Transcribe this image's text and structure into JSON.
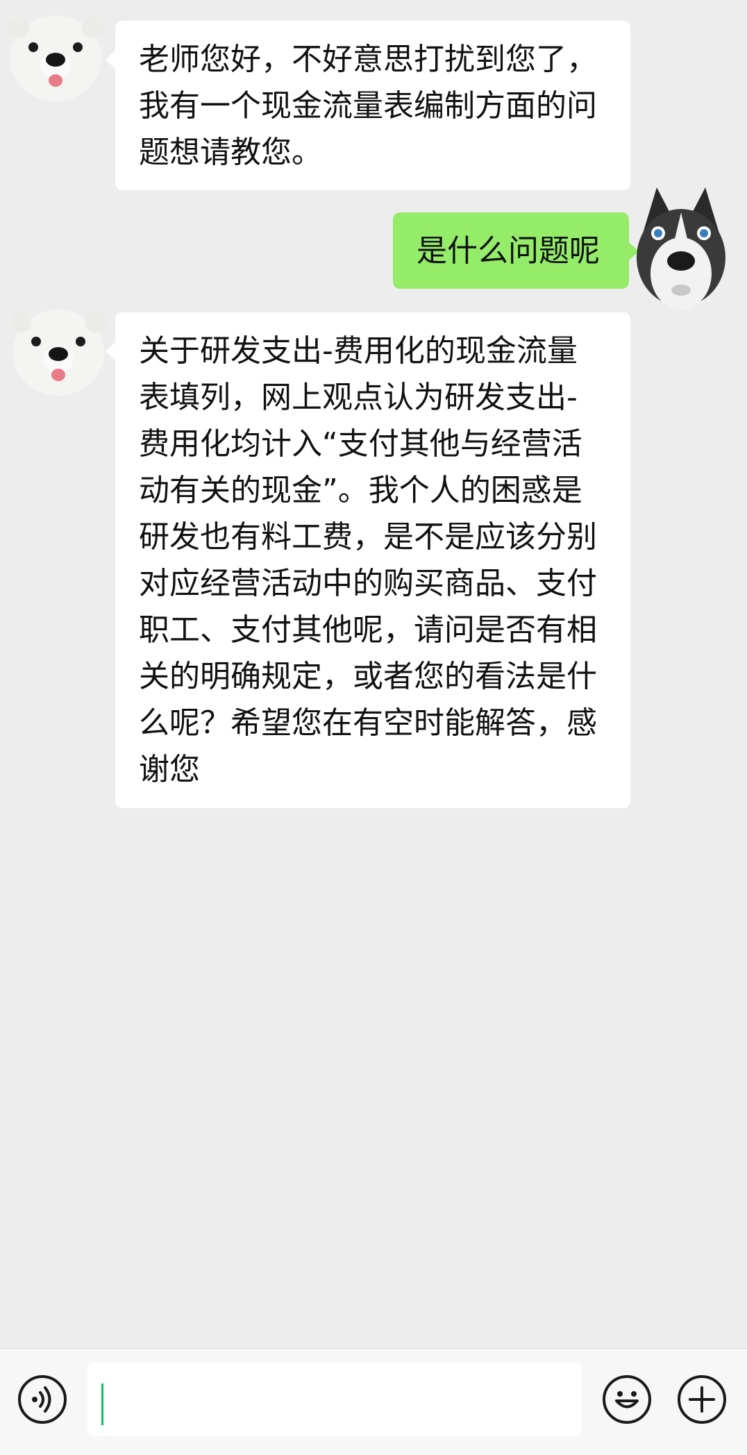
{
  "colors": {
    "background": "#ededed",
    "incoming_bubble": "#ffffff",
    "outgoing_bubble": "#95ec69",
    "caret": "#07c160"
  },
  "messages": [
    {
      "sender": "other",
      "avatar_icon": "polar-bear-avatar-icon",
      "lines": [
        "老师您好，不好意思打扰到您了，",
        "我有一个现金流量表编制方面的问",
        "题想请教您。"
      ]
    },
    {
      "sender": "self",
      "avatar_icon": "husky-avatar-icon",
      "lines": [
        "是什么问题呢"
      ]
    },
    {
      "sender": "other",
      "avatar_icon": "polar-bear-avatar-icon",
      "lines": [
        "关于研发支出-费用化的现金流量",
        "表填列，网上观点认为研发支出-",
        "费用化均计入“支付其他与经营活",
        "动有关的现金”。我个人的困惑是",
        "研发也有料工费，是不是应该分别",
        "对应经营活动中的购买商品、支付",
        "职工、支付其他呢，请问是否有相",
        "关的明确规定，或者您的看法是什",
        "么呢？希望您在有空时能解答，感",
        "谢您"
      ]
    }
  ],
  "input_bar": {
    "voice_icon": "voice-icon",
    "input_value": "",
    "emoji_icon": "emoji-icon",
    "plus_icon": "plus-icon"
  }
}
